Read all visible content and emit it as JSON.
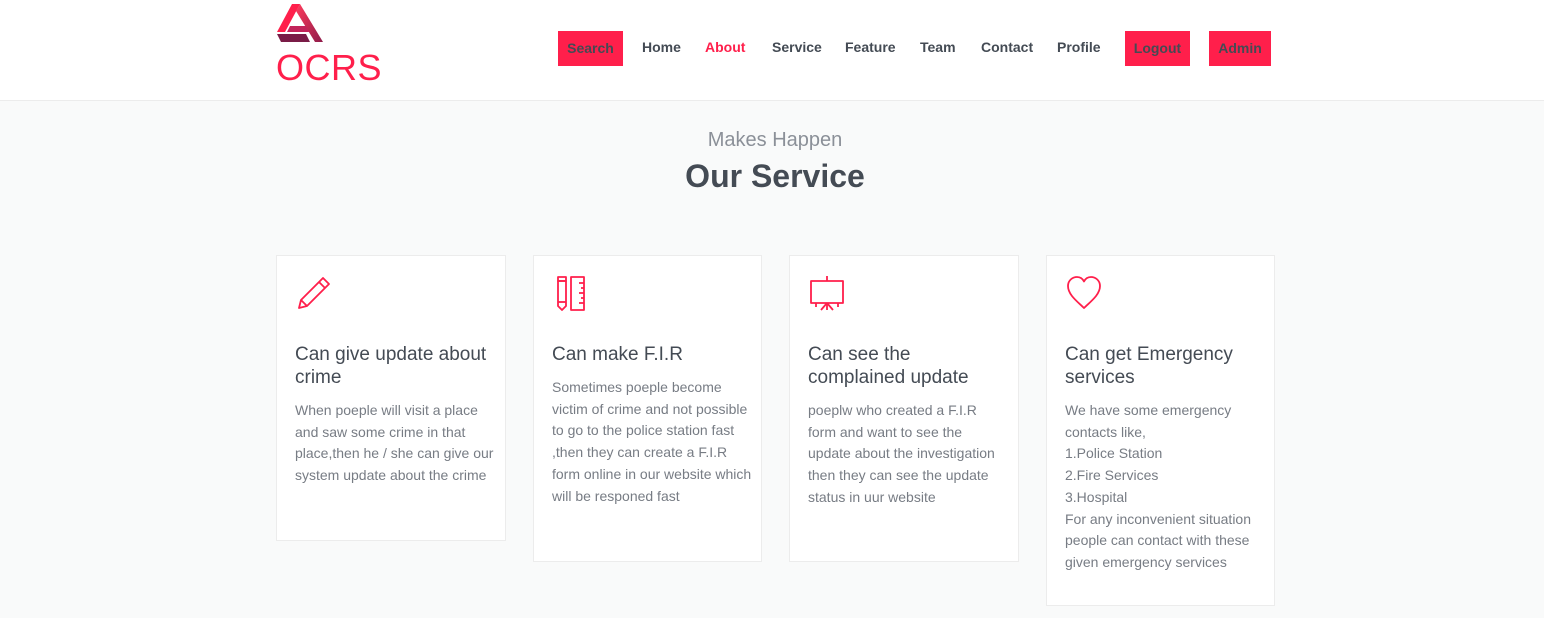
{
  "brand": {
    "name": "OCRS",
    "accent": "#ff1f4b"
  },
  "nav": {
    "search": "Search",
    "home": "Home",
    "about": "About",
    "service": "Service",
    "feature": "Feature",
    "team": "Team",
    "contact": "Contact",
    "profile": "Profile",
    "logout": "Logout",
    "admin": "Admin"
  },
  "section": {
    "eyebrow": "Makes Happen",
    "title": "Our Service"
  },
  "cards": [
    {
      "icon": "pencil-icon",
      "title": "Can give update about crime",
      "text": "When poeple will visit a place and saw some crime in that place,then he / she can give our system update about the crime"
    },
    {
      "icon": "pencil-ruler-icon",
      "title": "Can make F.I.R",
      "text": "Sometimes poeple become victim of crime and not possible to go to the police station fast ,then they can create a F.I.R form online in our website which will be responed fast"
    },
    {
      "icon": "presentation-board-icon",
      "title": "Can see the complained update",
      "text": "poeplw who created a F.I.R form and want to see the update about the investigation then they can see the update status in uur website"
    },
    {
      "icon": "heart-icon",
      "title": "Can get Emergency services",
      "text": "We have some emergency contacts like,\n1.Police Station\n2.Fire Services\n3.Hospital\nFor any inconvenient situation people can contact with these given emergency services"
    }
  ]
}
